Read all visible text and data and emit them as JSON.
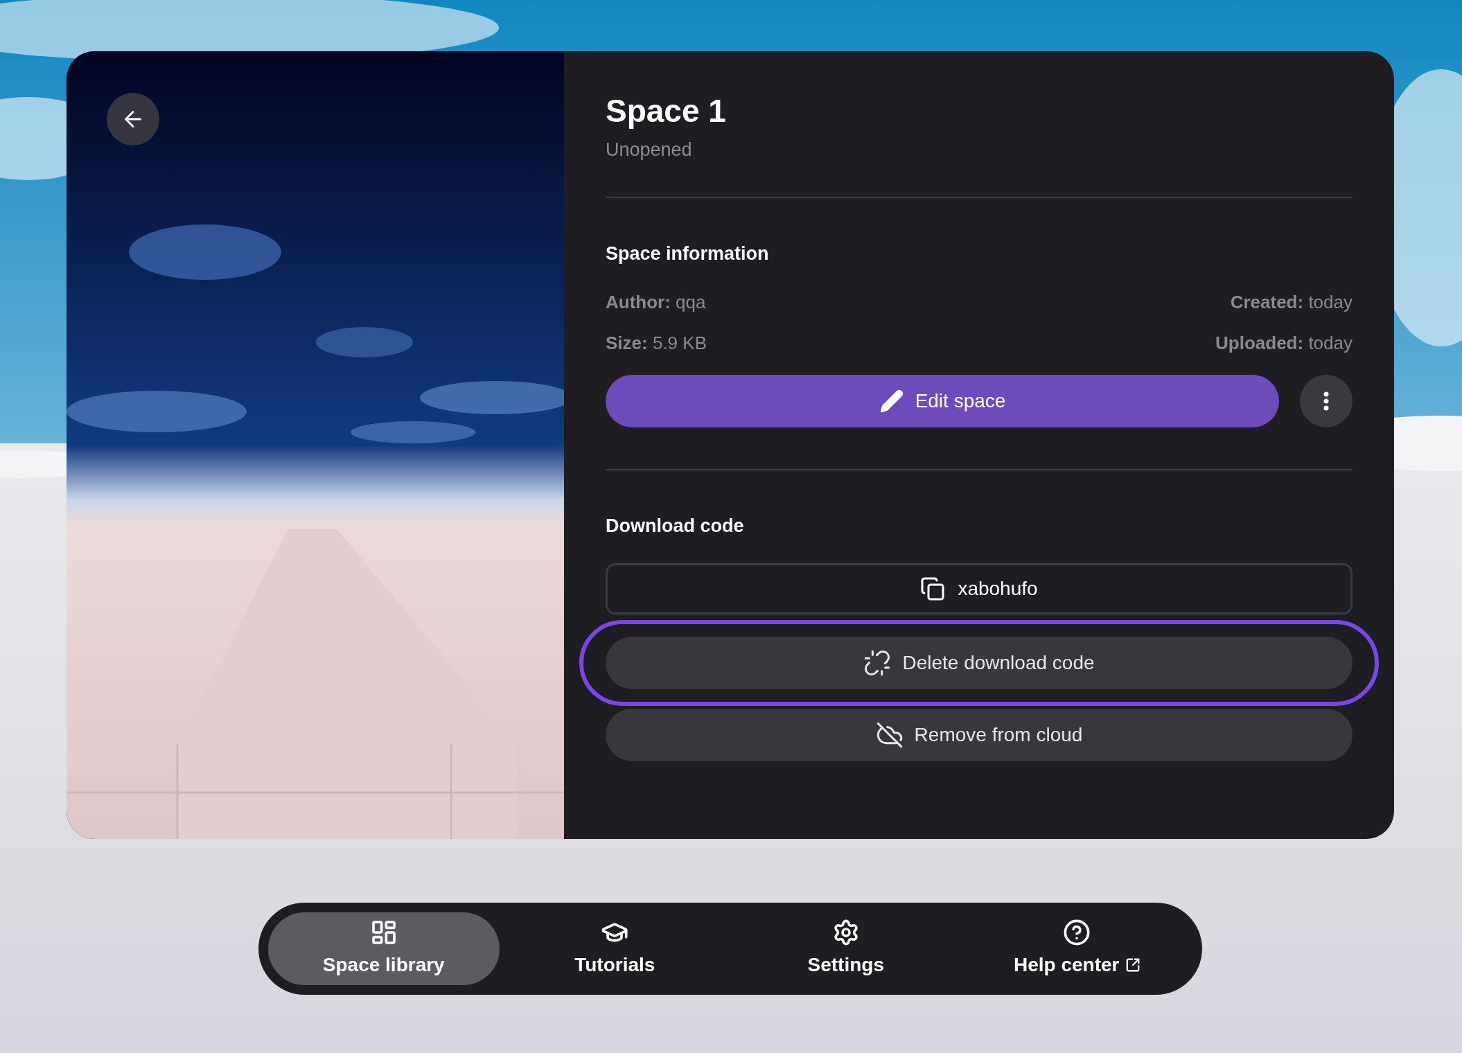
{
  "space": {
    "title": "Space 1",
    "status": "Unopened"
  },
  "info": {
    "heading": "Space information",
    "fields": [
      {
        "label": "Author:",
        "value": "qqa"
      },
      {
        "label": "Created:",
        "value": "today"
      },
      {
        "label": "Size:",
        "value": "5.9 KB"
      },
      {
        "label": "Uploaded:",
        "value": "today"
      }
    ]
  },
  "edit_button": {
    "label": "Edit space"
  },
  "download": {
    "heading": "Download code",
    "code": "xabohufo"
  },
  "buttons": [
    {
      "label": "Delete download code",
      "kind": "unlink",
      "focused": true
    },
    {
      "label": "Remove from cloud",
      "kind": "cloud-off",
      "focused": false
    }
  ],
  "nav": [
    {
      "label": "Space library",
      "kind": "library",
      "selected": true
    },
    {
      "label": "Tutorials",
      "kind": "tutorials",
      "selected": false
    },
    {
      "label": "Settings",
      "kind": "settings",
      "selected": false
    },
    {
      "label": "Help center",
      "kind": "help",
      "selected": false
    }
  ]
}
